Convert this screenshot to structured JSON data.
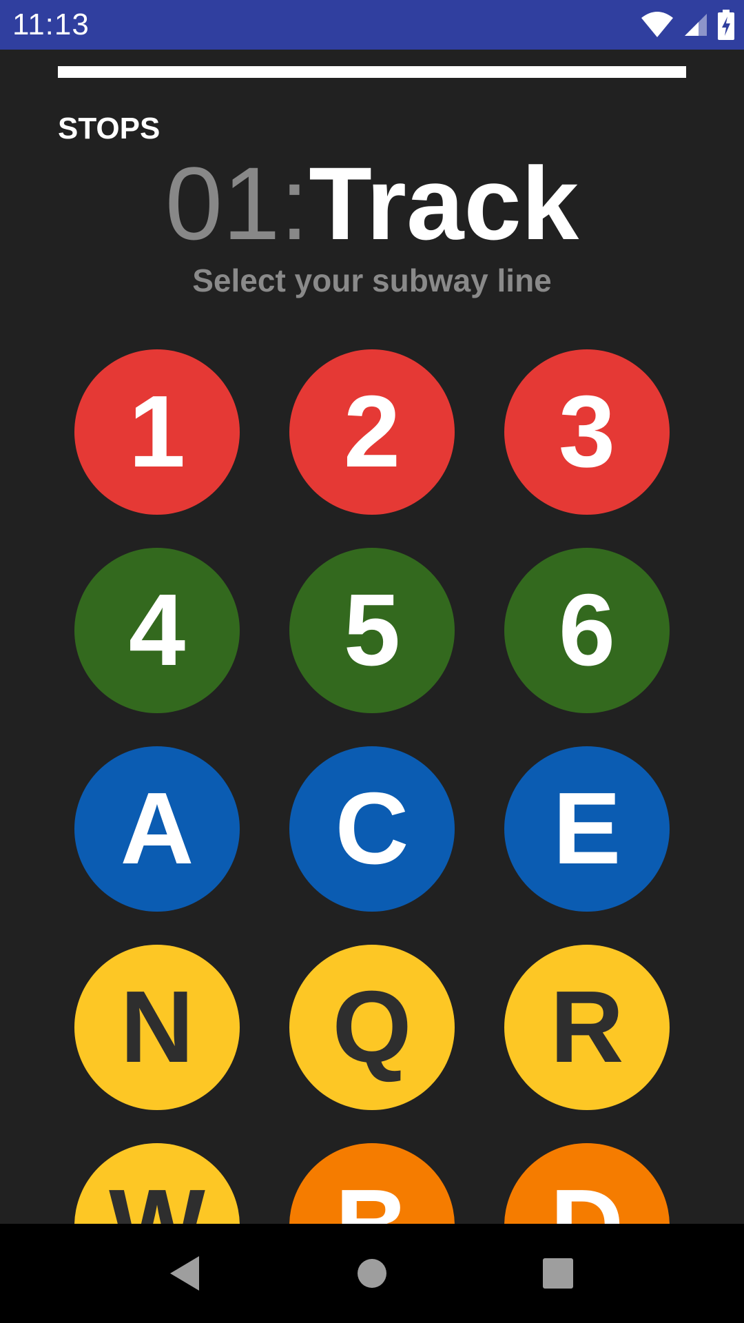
{
  "status_bar": {
    "time": "11:13",
    "icons": [
      "wifi-icon",
      "cell-signal-icon",
      "battery-charging-icon"
    ],
    "background": "#303F9F"
  },
  "header": {
    "section_label": "STOPS",
    "step_number": "01:",
    "title": "Track",
    "subtitle": "Select your subway line"
  },
  "lines": [
    {
      "label": "1",
      "bg": "#E53935",
      "fg": "#FFFFFF"
    },
    {
      "label": "2",
      "bg": "#E53935",
      "fg": "#FFFFFF"
    },
    {
      "label": "3",
      "bg": "#E53935",
      "fg": "#FFFFFF"
    },
    {
      "label": "4",
      "bg": "#33691E",
      "fg": "#FFFFFF"
    },
    {
      "label": "5",
      "bg": "#33691E",
      "fg": "#FFFFFF"
    },
    {
      "label": "6",
      "bg": "#33691E",
      "fg": "#FFFFFF"
    },
    {
      "label": "A",
      "bg": "#0B5CB2",
      "fg": "#FFFFFF"
    },
    {
      "label": "C",
      "bg": "#0B5CB2",
      "fg": "#FFFFFF"
    },
    {
      "label": "E",
      "bg": "#0B5CB2",
      "fg": "#FFFFFF"
    },
    {
      "label": "N",
      "bg": "#FDC725",
      "fg": "#2E2E2E"
    },
    {
      "label": "Q",
      "bg": "#FDC725",
      "fg": "#2E2E2E"
    },
    {
      "label": "R",
      "bg": "#FDC725",
      "fg": "#2E2E2E"
    },
    {
      "label": "W",
      "bg": "#FDC725",
      "fg": "#2E2E2E"
    },
    {
      "label": "B",
      "bg": "#F57C00",
      "fg": "#FFFFFF"
    },
    {
      "label": "D",
      "bg": "#F57C00",
      "fg": "#FFFFFF"
    }
  ],
  "nav": {
    "back": "back-icon",
    "home": "home-icon",
    "recents": "recents-icon"
  }
}
